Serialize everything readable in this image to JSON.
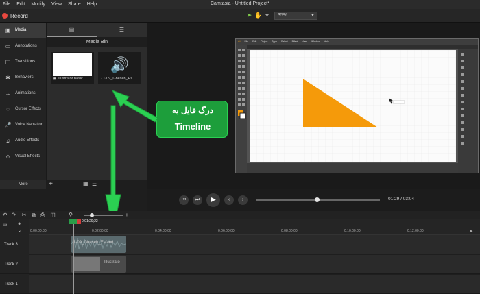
{
  "app": {
    "title": "Camtasia - Untitled Project*",
    "menu": [
      "File",
      "Edit",
      "Modify",
      "View",
      "Share",
      "Help"
    ]
  },
  "toolbar": {
    "record_label": "Record",
    "zoom_value": "35%"
  },
  "tabs": [
    {
      "label": "Media",
      "icon": "media-icon"
    },
    {
      "label": "Annotations",
      "icon": "annotations-icon"
    },
    {
      "label": "Transitions",
      "icon": "transitions-icon"
    },
    {
      "label": "Behaviors",
      "icon": "behaviors-icon"
    },
    {
      "label": "Animations",
      "icon": "animations-icon"
    },
    {
      "label": "Cursor Effects",
      "icon": "cursor-effects-icon"
    },
    {
      "label": "Voice Narration",
      "icon": "microphone-icon"
    },
    {
      "label": "Audio Effects",
      "icon": "audio-effects-icon"
    },
    {
      "label": "Visual Effects",
      "icon": "visual-effects-icon"
    }
  ],
  "more_label": "More",
  "media_bin": {
    "header": "Media Bin",
    "items": [
      {
        "caption": "Illustrator basic...",
        "icon": "image-icon"
      },
      {
        "caption": "1-09_Gheseh_Es...",
        "icon": "audio-icon"
      }
    ]
  },
  "annotation": {
    "line1": "درگ فایل به",
    "line2": "Timeline",
    "color": "#1d9e3b"
  },
  "playback": {
    "time_current": "01:29",
    "time_total": "03:04",
    "progress": 0.49
  },
  "timeline": {
    "playhead_time": "0:01:29;22",
    "ruler": [
      "0:00:00;00",
      "0:02:00;00",
      "0:04:00;00",
      "0:06:00;00",
      "0:08:00;00",
      "0:10:00;00",
      "0:12:00;00"
    ],
    "tracks": [
      {
        "label": "Track 3",
        "clip": "1-09_Gheseh_Esfand"
      },
      {
        "label": "Track 2",
        "clip": "Illustrato"
      },
      {
        "label": "Track 1",
        "clip": ""
      }
    ]
  },
  "illustrator": {
    "menu": [
      "Ai",
      "File",
      "Edit",
      "Object",
      "Type",
      "Select",
      "Effect",
      "View",
      "Window",
      "Help"
    ],
    "triangle_color": "#f59a0a"
  }
}
